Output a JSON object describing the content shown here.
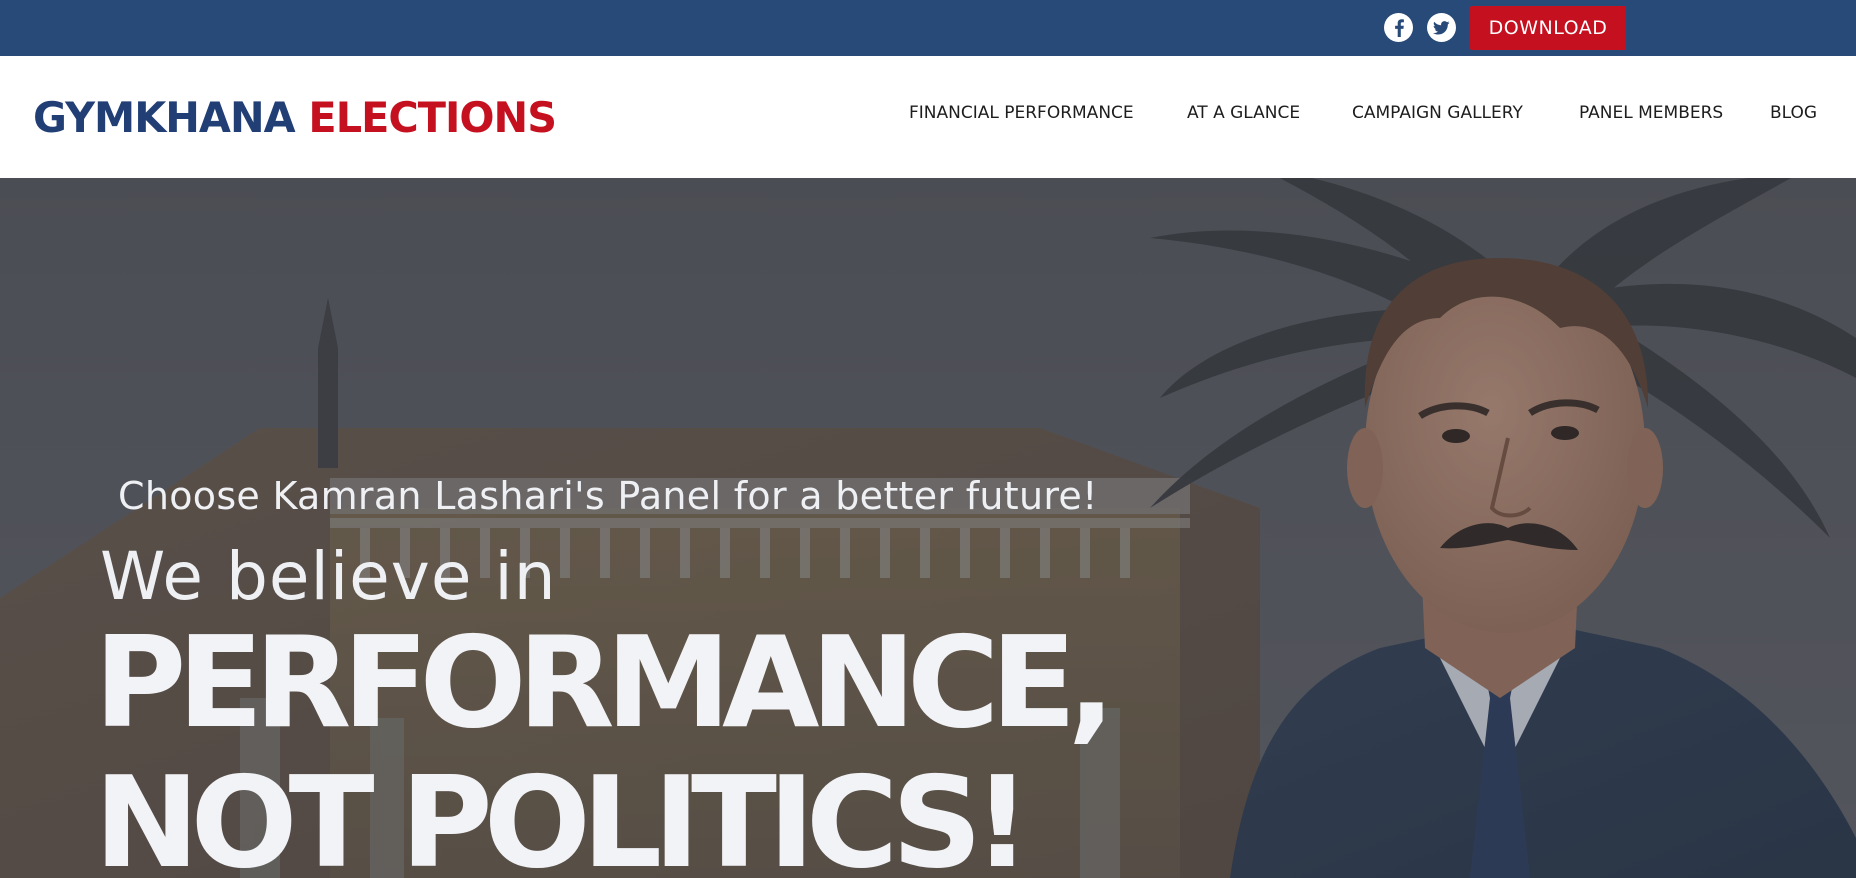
{
  "colors": {
    "topbar": "#284a78",
    "accent_red": "#c5101f",
    "logo_blue": "#223f75"
  },
  "topbar": {
    "social": [
      {
        "name": "facebook",
        "icon": "facebook-icon"
      },
      {
        "name": "twitter",
        "icon": "twitter-icon"
      }
    ],
    "download_label": "DOWNLOAD"
  },
  "header": {
    "logo": {
      "part1": "GYMKHANA",
      "part2": "ELECTIONS"
    },
    "nav": [
      {
        "label": "FINANCIAL PERFORMANCE"
      },
      {
        "label": "AT A GLANCE"
      },
      {
        "label": "CAMPAIGN GALLERY"
      },
      {
        "label": "PANEL MEMBERS"
      },
      {
        "label": "BLOG"
      }
    ]
  },
  "hero": {
    "subtitle": "Choose Kamran Lashari's Panel for a better future!",
    "line1": "We believe in",
    "line2": "PERFORMANCE,",
    "line3": "NOT POLITICS!"
  }
}
